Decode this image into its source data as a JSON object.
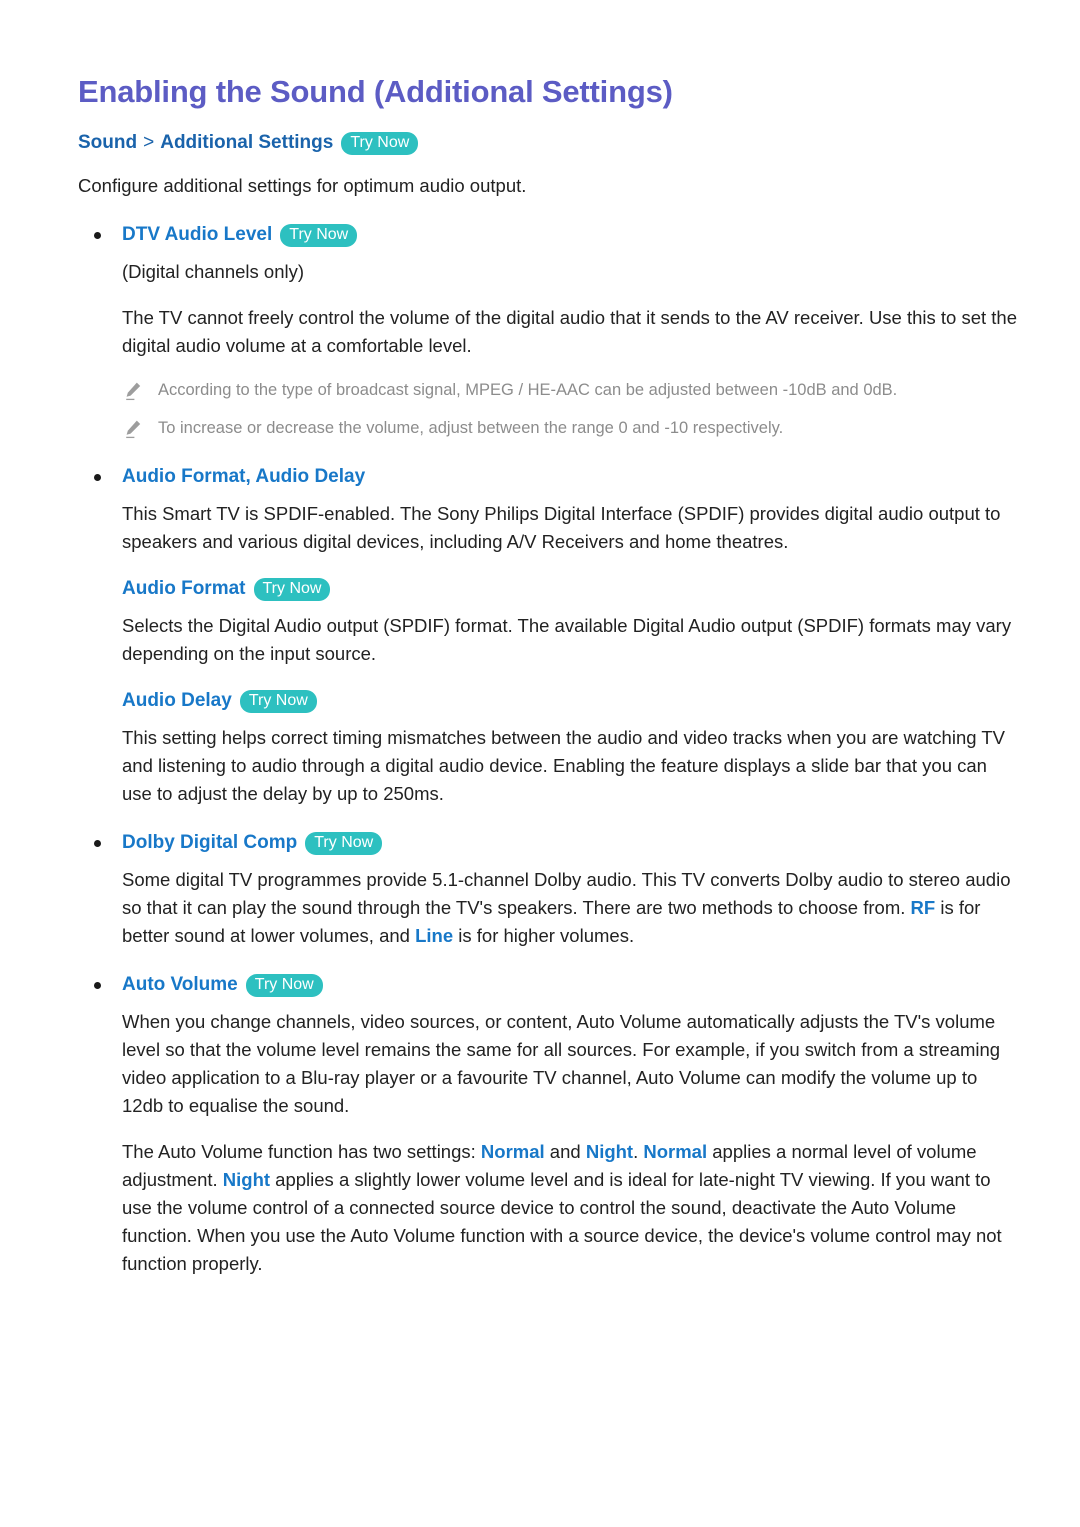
{
  "colors": {
    "title": "#5c5cc4",
    "breadcrumb": "#1a63ab",
    "heading_link": "#1878c8",
    "badge_bg": "#2dc0c0",
    "badge_text": "#ffffff",
    "body_text": "#222222",
    "note_text": "#8c8c8c"
  },
  "title": "Enabling the Sound (Additional Settings)",
  "breadcrumb": {
    "items": [
      "Sound",
      "Additional Settings"
    ],
    "separator": ">",
    "try_now": "Try Now"
  },
  "intro": "Configure additional settings for optimum audio output.",
  "badge_label": "Try Now",
  "sections": {
    "dtv_audio_level": {
      "heading": "DTV Audio Level",
      "badge": "Try Now",
      "note_parenthetical": "(Digital channels only)",
      "paragraph": "The TV cannot freely control the volume of the digital audio that it sends to the AV receiver. Use this to set the digital audio volume at a comfortable level.",
      "notes": [
        "According to the type of broadcast signal, MPEG / HE-AAC can be adjusted between -10dB and 0dB.",
        "To increase or decrease the volume, adjust between the range 0 and -10 respectively."
      ],
      "note_icon": "pencil-icon"
    },
    "audio_format_delay": {
      "heading": "Audio Format, Audio Delay",
      "paragraph": "This Smart TV is SPDIF-enabled. The Sony Philips Digital Interface (SPDIF) provides digital audio output to speakers and various digital devices, including A/V Receivers and home theatres."
    },
    "audio_format": {
      "heading": "Audio Format",
      "badge": "Try Now",
      "paragraph": "Selects the Digital Audio output (SPDIF) format. The available Digital Audio output (SPDIF) formats may vary depending on the input source."
    },
    "audio_delay": {
      "heading": "Audio Delay",
      "badge": "Try Now",
      "paragraph": "This setting helps correct timing mismatches between the audio and video tracks when you are watching TV and listening to audio through a digital audio device. Enabling the feature displays a slide bar that you can use to adjust the delay by up to 250ms."
    },
    "dolby_digital_comp": {
      "heading": "Dolby Digital Comp",
      "badge": "Try Now",
      "paragraph_part1": "Some digital TV programmes provide 5.1-channel Dolby audio. This TV converts Dolby audio to stereo audio so that it can play the sound through the TV's speakers. There are two methods to choose from. ",
      "highlight_rf": "RF",
      "paragraph_part2": " is for better sound at lower volumes, and ",
      "highlight_line": "Line",
      "paragraph_part3": " is for higher volumes."
    },
    "auto_volume": {
      "heading": "Auto Volume",
      "badge": "Try Now",
      "paragraph1": "When you change channels, video sources, or content, Auto Volume automatically adjusts the TV's volume level so that the volume level remains the same for all sources. For example, if you switch from a streaming video application to a Blu-ray player or a favourite TV channel, Auto Volume can modify the volume up to 12db to equalise the sound.",
      "paragraph2_part1": "The Auto Volume function has two settings: ",
      "highlight_normal_1": "Normal",
      "paragraph2_part2": " and ",
      "highlight_night_1": "Night",
      "paragraph2_part3": ". ",
      "highlight_normal_2": "Normal",
      "paragraph2_part4": " applies a normal level of volume adjustment. ",
      "highlight_night_2": "Night",
      "paragraph2_part5": " applies a slightly lower volume level and is ideal for late-night TV viewing. If you want to use the volume control of a connected source device to control the sound, deactivate the Auto Volume function. When you use the Auto Volume function with a source device, the device's volume control may not function properly."
    }
  }
}
